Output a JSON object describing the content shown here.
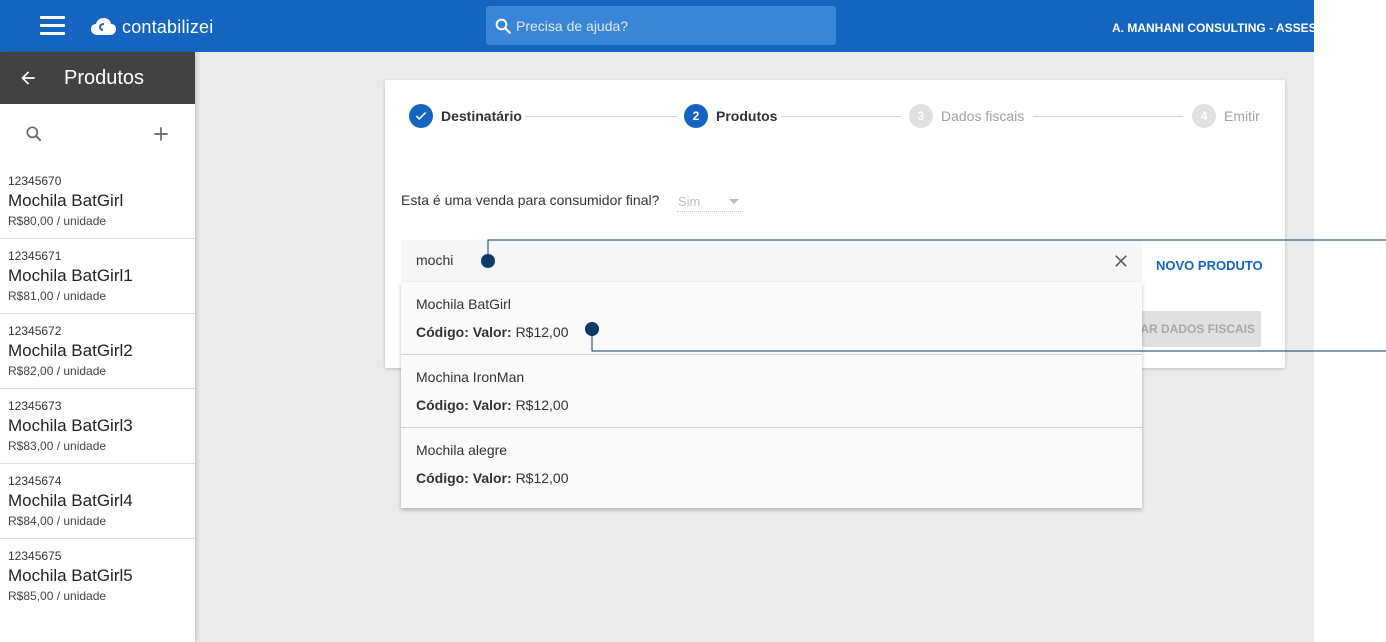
{
  "app": {
    "logo_text": "contabilizei",
    "search_placeholder": "Precisa de ajuda?",
    "company_name": "A. MANHANI CONSULTING - ASSESSORIA"
  },
  "sidebar": {
    "title": "Produtos",
    "products": [
      {
        "code": "12345670",
        "name": "Mochila BatGirl",
        "price": "R$80,00 / unidade"
      },
      {
        "code": "12345671",
        "name": "Mochila BatGirl1",
        "price": "R$81,00 / unidade"
      },
      {
        "code": "12345672",
        "name": "Mochila BatGirl2",
        "price": "R$82,00 / unidade"
      },
      {
        "code": "12345673",
        "name": "Mochila BatGirl3",
        "price": "R$83,00 / unidade"
      },
      {
        "code": "12345674",
        "name": "Mochila BatGirl4",
        "price": "R$84,00 / unidade"
      },
      {
        "code": "12345675",
        "name": "Mochila BatGirl5",
        "price": "R$85,00 / unidade"
      }
    ]
  },
  "stepper": {
    "steps": [
      {
        "number": "✓",
        "label": "Destinatário",
        "state": "done"
      },
      {
        "number": "2",
        "label": "Produtos",
        "state": "active"
      },
      {
        "number": "3",
        "label": "Dados fiscais",
        "state": "inactive"
      },
      {
        "number": "4",
        "label": "Emitir",
        "state": "inactive"
      }
    ]
  },
  "form": {
    "question": "Esta é uma venda para consumidor final?",
    "final_consumer_value": "Sim",
    "novo_produto_label": "NOVO PRODUTO",
    "fiscal_button_label": "AR DADOS FISCAIS"
  },
  "autocomplete": {
    "query": "mochi",
    "code_label": "Código:",
    "value_label": "Valor:",
    "results": [
      {
        "name": "Mochila BatGirl",
        "value": "R$12,00"
      },
      {
        "name": "Mochina IronMan",
        "value": "R$12,00"
      },
      {
        "name": "Mochila alegre",
        "value": "R$12,00"
      }
    ]
  },
  "colors": {
    "primary": "#1565c0",
    "sidebar_header": "#424242",
    "main_background": "#ebebeb",
    "callout": "#0d3a66"
  },
  "icons": [
    "menu-icon",
    "cloud-logo-icon",
    "search-icon",
    "arrow-back-icon",
    "add-icon",
    "check-icon",
    "close-icon",
    "caret-down-icon"
  ]
}
